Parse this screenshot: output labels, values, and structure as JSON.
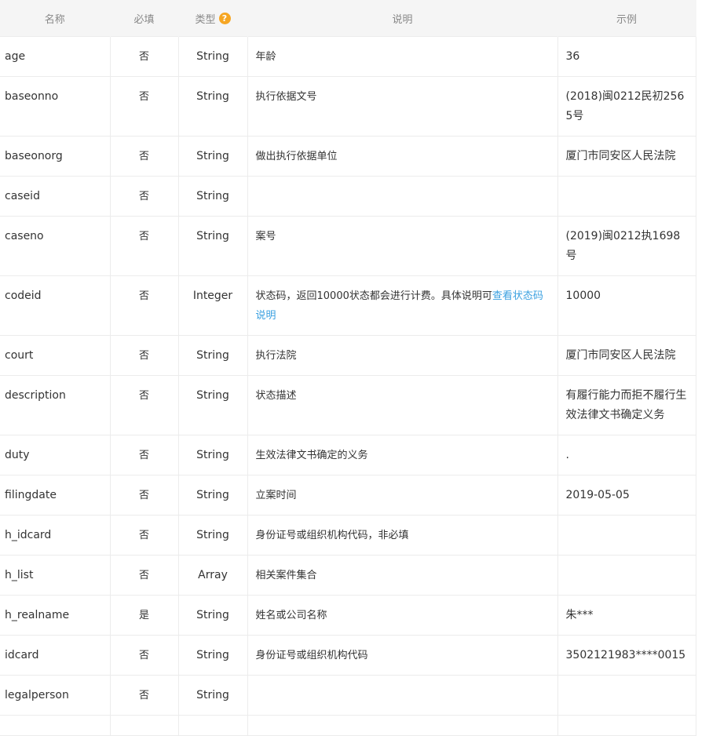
{
  "header": {
    "name": "名称",
    "required": "必填",
    "type": "类型",
    "help_icon": "question-circle-icon",
    "description": "说明",
    "example": "示例"
  },
  "colors": {
    "header_bg": "#f5f5f5",
    "help_icon": "#f6a623",
    "link": "#3aa0e0"
  },
  "rows": [
    {
      "name": "age",
      "required": "否",
      "type": "String",
      "description": "年龄",
      "example": "36"
    },
    {
      "name": "baseonno",
      "required": "否",
      "type": "String",
      "description": "执行依据文号",
      "example": "(2018)闽0212民初2565号"
    },
    {
      "name": "baseonorg",
      "required": "否",
      "type": "String",
      "description": "做出执行依据单位",
      "example": "厦门市同安区人民法院"
    },
    {
      "name": "caseid",
      "required": "否",
      "type": "String",
      "description": "",
      "example": ""
    },
    {
      "name": "caseno",
      "required": "否",
      "type": "String",
      "description": "案号",
      "example": "(2019)闽0212执1698号"
    },
    {
      "name": "codeid",
      "required": "否",
      "type": "Integer",
      "description": "状态码，返回10000状态都会进行计费。具体说明可",
      "link": "查看状态码说明",
      "example": "10000"
    },
    {
      "name": "court",
      "required": "否",
      "type": "String",
      "description": "执行法院",
      "example": "厦门市同安区人民法院"
    },
    {
      "name": "description",
      "required": "否",
      "type": "String",
      "description": "状态描述",
      "example": "有履行能力而拒不履行生效法律文书确定义务"
    },
    {
      "name": "duty",
      "required": "否",
      "type": "String",
      "description": "生效法律文书确定的义务",
      "example": "."
    },
    {
      "name": "filingdate",
      "required": "否",
      "type": "String",
      "description": "立案时间",
      "example": "2019-05-05"
    },
    {
      "name": "h_idcard",
      "required": "否",
      "type": "String",
      "description": "身份证号或组织机构代码，非必填",
      "example": ""
    },
    {
      "name": "h_list",
      "required": "否",
      "type": "Array",
      "description": "相关案件集合",
      "example": ""
    },
    {
      "name": "h_realname",
      "required": "是",
      "type": "String",
      "description": "姓名或公司名称",
      "example": "朱***"
    },
    {
      "name": "idcard",
      "required": "否",
      "type": "String",
      "description": "身份证号或组织机构代码",
      "example": "3502121983****0015"
    },
    {
      "name": "legalperson",
      "required": "否",
      "type": "String",
      "description": "",
      "example": ""
    },
    {
      "name": "",
      "required": "",
      "type": "",
      "description": "",
      "example": ""
    }
  ]
}
